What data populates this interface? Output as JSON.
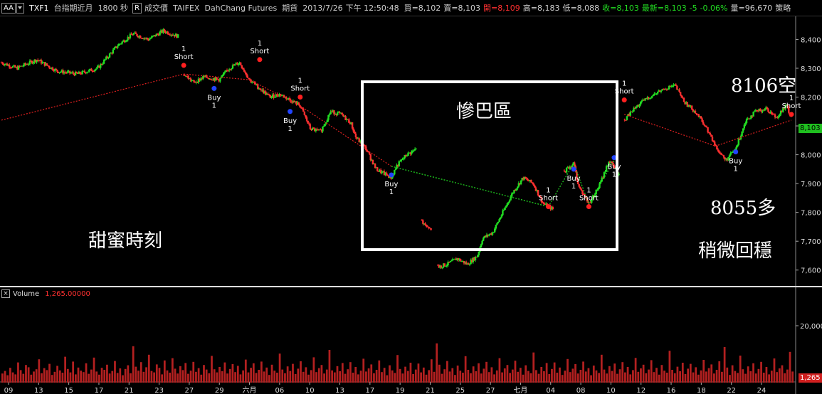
{
  "toolbar": {
    "period_btn": "AA",
    "symbol": "TXF1",
    "symbol_name": "台指期近月",
    "interval": "1800 秒",
    "r_btn": "R",
    "price_type": "成交價",
    "exchange": "TAIFEX",
    "broker": "DahChang Futures",
    "market": "期貨",
    "date": "2013/7/26",
    "time": "下午 12:50:48",
    "bid": "買=8,102",
    "ask": "賣=8,103",
    "open": "開=8,109",
    "high": "高=8,183",
    "low": "低=8,088",
    "close": "收=8,103",
    "last": "最新=8,103",
    "change": "-5",
    "change_pct": "-0.06%",
    "volume": "量=96,670",
    "strategy": "策略"
  },
  "colors": {
    "up": "#22dd22",
    "down": "#ff3030",
    "volume_bar": "#b32020",
    "buy_marker": "#2244ff",
    "sell_marker": "#ff2020"
  },
  "annotations": {
    "sweet": "甜蜜時刻",
    "tragic": "慘巴區",
    "short_level": "8106空",
    "long_level": "8055多",
    "stable": "稍微回穩"
  },
  "volume_panel": {
    "label": "Volume",
    "value": "1,265.00000",
    "last_tag": "1,265"
  },
  "price_tag": "8,103",
  "chart_data": {
    "type": "candlestick",
    "y_ticks": [
      "8,400",
      "8,300",
      "8,200",
      "8,100",
      "8,000",
      "7,900",
      "7,800",
      "7,700",
      "7,600"
    ],
    "ylim": [
      7550,
      8480
    ],
    "vol_ticks": [
      "20,000"
    ],
    "vol_ylim": [
      0,
      30000
    ],
    "x_ticks": [
      "09",
      "13",
      "15",
      "17",
      "21",
      "23",
      "27",
      "29",
      "六月",
      "06",
      "10",
      "13",
      "17",
      "19",
      "21",
      "25",
      "27",
      "七月",
      "04",
      "08",
      "10",
      "12",
      "16",
      "18",
      "22",
      "24"
    ],
    "path_points": [
      [
        0,
        8320
      ],
      [
        6,
        8300
      ],
      [
        14,
        8330
      ],
      [
        22,
        8290
      ],
      [
        30,
        8280
      ],
      [
        38,
        8300
      ],
      [
        46,
        8380
      ],
      [
        52,
        8420
      ],
      [
        58,
        8400
      ],
      [
        64,
        8430
      ],
      [
        70,
        8410
      ],
      [
        72,
        8280
      ],
      [
        76,
        8250
      ],
      [
        80,
        8270
      ],
      [
        86,
        8260
      ],
      [
        90,
        8300
      ],
      [
        94,
        8320
      ],
      [
        98,
        8260
      ],
      [
        102,
        8230
      ],
      [
        106,
        8200
      ],
      [
        110,
        8210
      ],
      [
        114,
        8190
      ],
      [
        118,
        8170
      ],
      [
        122,
        8090
      ],
      [
        126,
        8080
      ],
      [
        130,
        8150
      ],
      [
        134,
        8140
      ],
      [
        138,
        8110
      ],
      [
        140,
        8060
      ],
      [
        144,
        8020
      ],
      [
        148,
        7950
      ],
      [
        152,
        7930
      ],
      [
        154,
        7920
      ],
      [
        156,
        7960
      ],
      [
        160,
        8000
      ],
      [
        164,
        8020
      ],
      [
        166,
        7770
      ],
      [
        170,
        7740
      ],
      [
        172,
        7610
      ],
      [
        176,
        7620
      ],
      [
        180,
        7640
      ],
      [
        184,
        7620
      ],
      [
        188,
        7650
      ],
      [
        190,
        7710
      ],
      [
        194,
        7730
      ],
      [
        198,
        7800
      ],
      [
        202,
        7870
      ],
      [
        206,
        7920
      ],
      [
        210,
        7900
      ],
      [
        214,
        7830
      ],
      [
        218,
        7810
      ],
      [
        222,
        7940
      ],
      [
        226,
        7970
      ],
      [
        228,
        7890
      ],
      [
        232,
        7830
      ],
      [
        236,
        7890
      ],
      [
        240,
        7980
      ],
      [
        244,
        7930
      ],
      [
        246,
        8120
      ],
      [
        250,
        8160
      ],
      [
        254,
        8190
      ],
      [
        258,
        8210
      ],
      [
        262,
        8230
      ],
      [
        266,
        8240
      ],
      [
        270,
        8180
      ],
      [
        274,
        8150
      ],
      [
        278,
        8100
      ],
      [
        282,
        8030
      ],
      [
        286,
        7980
      ],
      [
        290,
        8020
      ],
      [
        294,
        8120
      ],
      [
        298,
        8150
      ],
      [
        302,
        8160
      ],
      [
        306,
        8130
      ],
      [
        310,
        8170
      ],
      [
        312,
        8130
      ]
    ],
    "volume_values": [
      3200,
      4100,
      2600,
      5200,
      3600,
      2900,
      7100,
      4400,
      3100,
      6200,
      5400,
      2800,
      3900,
      4700,
      8200,
      3300,
      5100,
      4400,
      6600,
      2700,
      3800,
      5900,
      4300,
      3500,
      9100,
      4800,
      3600,
      7400,
      2900,
      5300,
      4200,
      3700,
      6800,
      3100,
      4600,
      8800,
      3900,
      2800,
      5200,
      4500,
      6300,
      3200,
      4100,
      7600,
      3400,
      5000,
      2600,
      4800,
      6100,
      3300,
      12800,
      5600,
      4200,
      7200,
      3800,
      5400,
      9800,
      4100,
      3600,
      6400,
      5200,
      2900,
      7800,
      4300,
      3500,
      8600,
      4900,
      3200,
      5800,
      4400,
      6900,
      3100,
      4200,
      7300,
      3800,
      5100,
      2800,
      6200,
      4600,
      3300,
      9400,
      4700,
      3600,
      5500,
      4000,
      7100,
      3200,
      4800,
      6500,
      3700,
      5900,
      2900,
      4300,
      8100,
      3600,
      5200,
      6800,
      3400,
      4500,
      7400,
      3900,
      5300,
      2700,
      6300,
      4200,
      3500,
      10200,
      4600,
      3300,
      5700,
      4100,
      6600,
      3000,
      4900,
      7500,
      3800,
      5400,
      2800,
      4400,
      8900,
      3700,
      5100,
      6200,
      3200,
      4600,
      11500,
      4300,
      3600,
      5800,
      4000,
      6900,
      3100,
      4700,
      7200,
      3500,
      5500,
      2900,
      4200,
      8400,
      3900,
      5000,
      6400,
      3300,
      4500,
      7800,
      3700,
      5200,
      2600,
      6100,
      4300,
      3400,
      9700,
      4800,
      3200,
      5600,
      4100,
      7000,
      3000,
      4600,
      6700,
      3600,
      5300,
      2800,
      4400,
      8200,
      3800,
      13800,
      6300,
      3100,
      4700,
      7600,
      3900,
      5100,
      2700,
      6000,
      4200,
      3500,
      9300,
      4500,
      3300,
      5700,
      4000,
      6800,
      3200,
      4900,
      7300,
      3700,
      5400,
      2900,
      4300,
      8600,
      3600,
      5000,
      6200,
      3400,
      4600,
      7700,
      3800,
      5200,
      2800,
      6100,
      4100,
      3300,
      10600,
      4400,
      3100,
      5500,
      4000,
      6900,
      3000,
      4800,
      7100,
      3500,
      5300,
      2700,
      4200,
      8300,
      3700,
      4900,
      6500,
      3200,
      4500,
      7400,
      3900,
      5100,
      2600,
      6000,
      4300,
      3400,
      9800,
      4600,
      3200,
      5800,
      4100,
      6700,
      3100,
      4700,
      7200,
      3600,
      5500,
      2900,
      4400,
      8700,
      3800,
      5000,
      6300,
      3300,
      4600,
      7900,
      3700,
      5200,
      2800,
      6200,
      4200,
      3500,
      11200,
      4500,
      3300,
      5600,
      4000,
      7000,
      3000,
      4900,
      6600,
      3600,
      5400,
      2800,
      4300,
      8000,
      3900,
      5100,
      6400,
      3200,
      4500,
      7500,
      3800,
      12500,
      5300,
      2700,
      6100,
      4100,
      3400,
      9500,
      4700,
      3100,
      5700,
      4000,
      6800,
      3200,
      4800,
      7300,
      3500,
      5500,
      2900,
      4200,
      8500,
      3700,
      5000,
      6100,
      3300,
      4600,
      10800,
      3900
    ]
  }
}
